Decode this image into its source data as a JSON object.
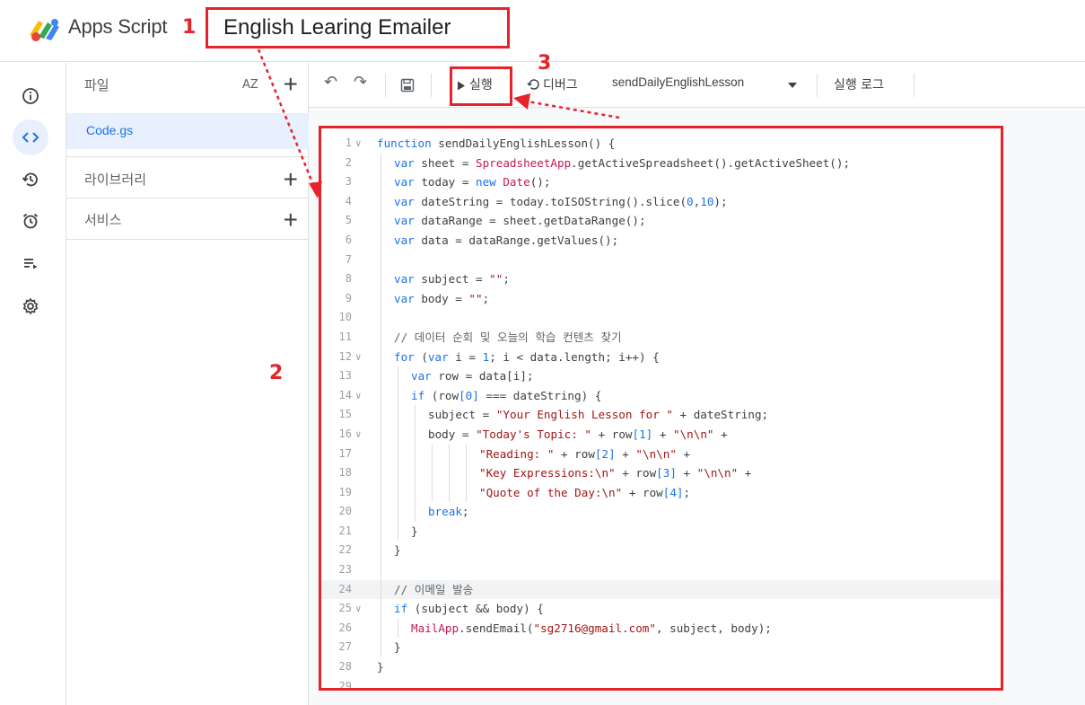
{
  "header": {
    "app_name": "Apps Script",
    "project_title": "English Learing Emailer"
  },
  "annotations": {
    "n1": "1",
    "n2": "2",
    "n3": "3"
  },
  "rail": {
    "items": [
      {
        "icon": "info-icon"
      },
      {
        "icon": "code-icon"
      },
      {
        "icon": "history-icon"
      },
      {
        "icon": "alarm-icon"
      },
      {
        "icon": "executions-icon"
      },
      {
        "icon": "gear-icon"
      }
    ],
    "active": "code-icon"
  },
  "files_panel": {
    "files_label": "파일",
    "sort_label": "AZ",
    "add_label": "+",
    "active_file": "Code.gs",
    "libraries_label": "라이브러리",
    "services_label": "서비스"
  },
  "toolbar": {
    "undo": "↶",
    "redo": "↷",
    "save": "💾",
    "run_label": "실행",
    "debug_label": "디버그",
    "function_name": "sendDailyEnglishLesson",
    "log_label": "실행 로그"
  },
  "colors": {
    "annotation_red": "#e5232a",
    "accent_blue": "#1a73e8",
    "string_red": "#a31515"
  },
  "code": {
    "current_line": 24,
    "lines": [
      {
        "n": "1",
        "fold": true,
        "indent": 0,
        "t": "function sendDailyEnglishLesson() {"
      },
      {
        "n": "2",
        "fold": false,
        "indent": 1,
        "t": "var sheet = SpreadsheetApp.getActiveSpreadsheet().getActiveSheet();"
      },
      {
        "n": "3",
        "fold": false,
        "indent": 1,
        "t": "var today = new Date();"
      },
      {
        "n": "4",
        "fold": false,
        "indent": 1,
        "t": "var dateString = today.toISOString().slice(0,10);"
      },
      {
        "n": "5",
        "fold": false,
        "indent": 1,
        "t": "var dataRange = sheet.getDataRange();"
      },
      {
        "n": "6",
        "fold": false,
        "indent": 1,
        "t": "var data = dataRange.getValues();"
      },
      {
        "n": "7",
        "fold": false,
        "indent": 1,
        "t": ""
      },
      {
        "n": "8",
        "fold": false,
        "indent": 1,
        "t": "var subject = \"\";"
      },
      {
        "n": "9",
        "fold": false,
        "indent": 1,
        "t": "var body = \"\";"
      },
      {
        "n": "10",
        "fold": false,
        "indent": 1,
        "t": ""
      },
      {
        "n": "11",
        "fold": false,
        "indent": 1,
        "t": "// 데이터 순회 및 오늘의 학습 컨텐츠 찾기"
      },
      {
        "n": "12",
        "fold": true,
        "indent": 1,
        "t": "for (var i = 1; i < data.length; i++) {"
      },
      {
        "n": "13",
        "fold": false,
        "indent": 2,
        "t": "var row = data[i];"
      },
      {
        "n": "14",
        "fold": true,
        "indent": 2,
        "t": "if (row[0] === dateString) {"
      },
      {
        "n": "15",
        "fold": false,
        "indent": 3,
        "t": "subject = \"Your English Lesson for \" + dateString;"
      },
      {
        "n": "16",
        "fold": true,
        "indent": 3,
        "t": "body = \"Today's Topic: \" + row[1] + \"\\n\\n\" +"
      },
      {
        "n": "17",
        "fold": false,
        "indent": 6,
        "t": "\"Reading: \" + row[2] + \"\\n\\n\" +"
      },
      {
        "n": "18",
        "fold": false,
        "indent": 6,
        "t": "\"Key Expressions:\\n\" + row[3] + \"\\n\\n\" +"
      },
      {
        "n": "19",
        "fold": false,
        "indent": 6,
        "t": "\"Quote of the Day:\\n\" + row[4];"
      },
      {
        "n": "20",
        "fold": false,
        "indent": 3,
        "t": "break;"
      },
      {
        "n": "21",
        "fold": false,
        "indent": 2,
        "t": "}"
      },
      {
        "n": "22",
        "fold": false,
        "indent": 1,
        "t": "}"
      },
      {
        "n": "23",
        "fold": false,
        "indent": 1,
        "t": ""
      },
      {
        "n": "24",
        "fold": false,
        "indent": 1,
        "t": "// 이메일 발송"
      },
      {
        "n": "25",
        "fold": true,
        "indent": 1,
        "t": "if (subject && body) {"
      },
      {
        "n": "26",
        "fold": false,
        "indent": 2,
        "t": "MailApp.sendEmail(\"sg2716@gmail.com\", subject, body);"
      },
      {
        "n": "27",
        "fold": false,
        "indent": 1,
        "t": "}"
      },
      {
        "n": "28",
        "fold": false,
        "indent": 0,
        "t": "}"
      },
      {
        "n": "29",
        "fold": false,
        "indent": 0,
        "t": ""
      }
    ]
  }
}
